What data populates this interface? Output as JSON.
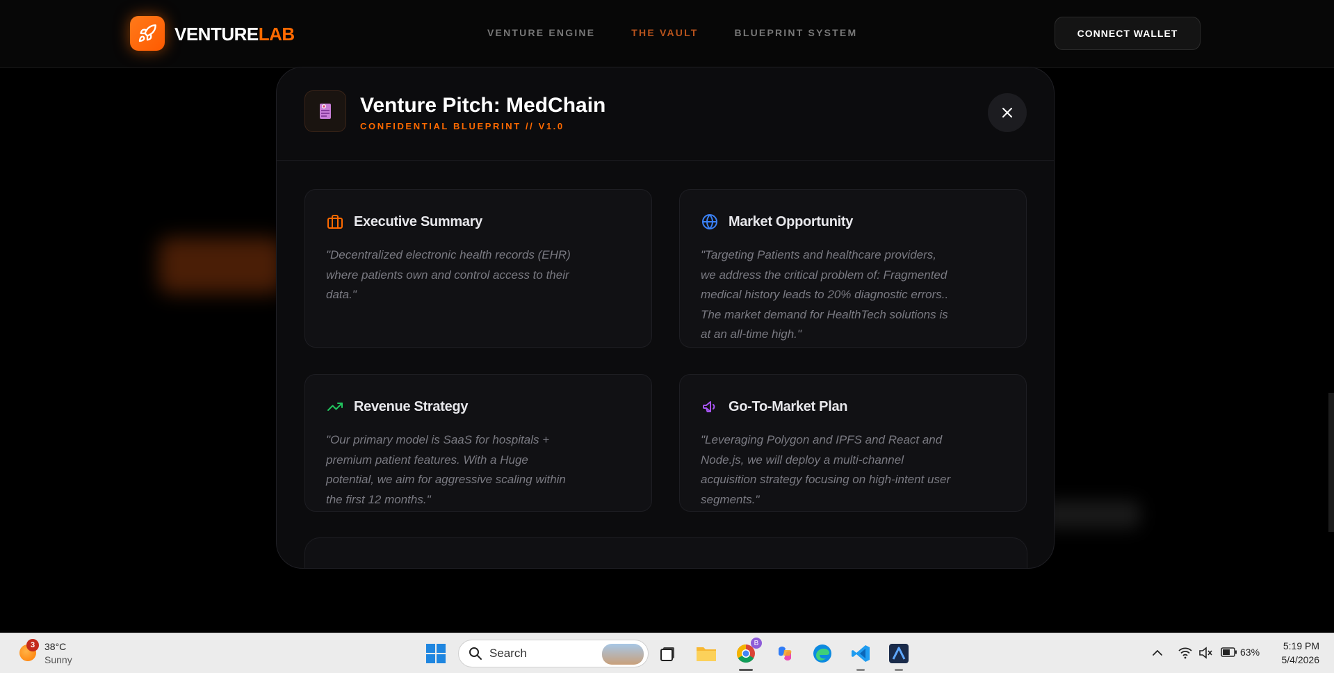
{
  "nav": {
    "logo_main": "VENTURE",
    "logo_accent": "LAB",
    "links": [
      "VENTURE ENGINE",
      "THE VAULT",
      "BLUEPRINT SYSTEM"
    ],
    "active_link": "THE VAULT",
    "wallet_button": "CONNECT WALLET"
  },
  "modal": {
    "title": "Venture Pitch: MedChain",
    "subtitle": "CONFIDENTIAL BLUEPRINT // V1.0",
    "cards": [
      {
        "title": "Executive Summary",
        "icon": "briefcase-icon",
        "icon_color": "#ff6a00",
        "body": "\"Decentralized electronic health records (EHR) where patients own and control access to their data.\""
      },
      {
        "title": "Market Opportunity",
        "icon": "globe-icon",
        "icon_color": "#3b82f6",
        "body": "\"Targeting Patients and healthcare providers, we address the critical problem of: Fragmented medical history leads to 20% diagnostic errors.. The market demand for HealthTech solutions is at an all-time high.\""
      },
      {
        "title": "Revenue Strategy",
        "icon": "trending-up-icon",
        "icon_color": "#22c55e",
        "body": "\"Our primary model is SaaS for hospitals + premium patient features. With a Huge potential, we aim for aggressive scaling within the first 12 months.\""
      },
      {
        "title": "Go-To-Market Plan",
        "icon": "megaphone-icon",
        "icon_color": "#a855f7",
        "body": "\"Leveraging Polygon and IPFS and React and Node.js, we will deploy a multi-channel acquisition strategy focusing on high-intent user segments.\""
      }
    ]
  },
  "taskbar": {
    "weather": {
      "badge": "3",
      "temp": "38°C",
      "condition": "Sunny"
    },
    "search_label": "Search",
    "chrome_badge": "B",
    "tray": {
      "battery": "63%"
    },
    "clock": {
      "time": "5:19 PM",
      "date": "5/4/2026"
    }
  },
  "colors": {
    "accent": "#ff6a00",
    "background": "#000000",
    "modal_bg": "#0c0c0e",
    "card_bg": "#111114"
  }
}
